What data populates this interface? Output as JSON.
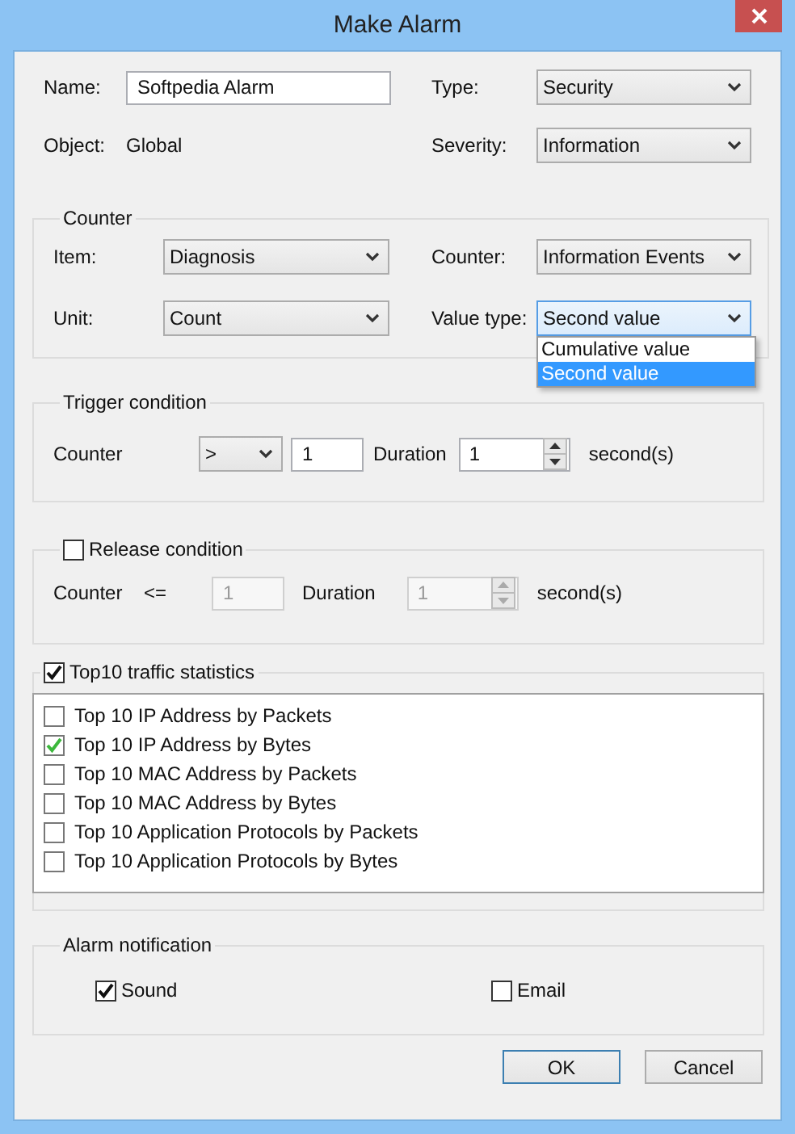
{
  "window": {
    "title": "Make Alarm"
  },
  "general": {
    "name": {
      "label": "Name:",
      "value": "Softpedia Alarm"
    },
    "object": {
      "label": "Object:",
      "value": "Global"
    },
    "type": {
      "label": "Type:",
      "value": "Security"
    },
    "severity": {
      "label": "Severity:",
      "value": "Information"
    }
  },
  "counter_group": {
    "title": "Counter",
    "item": {
      "label": "Item:",
      "value": "Diagnosis"
    },
    "counter": {
      "label": "Counter:",
      "value": "Information Events"
    },
    "unit": {
      "label": "Unit:",
      "value": "Count"
    },
    "value_type": {
      "label": "Value type:",
      "value": "Second value",
      "expanded": true,
      "options": [
        {
          "label": "Cumulative value",
          "selected": false
        },
        {
          "label": "Second value",
          "selected": true
        }
      ]
    }
  },
  "trigger": {
    "title": "Trigger condition",
    "counter_label": "Counter",
    "operator": ">",
    "threshold": "1",
    "duration_label": "Duration",
    "duration": "1",
    "unit": "second(s)"
  },
  "release": {
    "title": "Release condition",
    "checked": false,
    "counter_label": "Counter",
    "operator": "<=",
    "threshold": "1",
    "duration_label": "Duration",
    "duration": "1",
    "unit": "second(s)"
  },
  "top10": {
    "title": "Top10 traffic statistics",
    "checked": true,
    "items": [
      {
        "label": "Top 10 IP Address by Packets",
        "checked": false
      },
      {
        "label": "Top 10 IP Address by Bytes",
        "checked": true
      },
      {
        "label": "Top 10 MAC Address by Packets",
        "checked": false
      },
      {
        "label": "Top 10 MAC Address by Bytes",
        "checked": false
      },
      {
        "label": "Top 10 Application Protocols by Packets",
        "checked": false
      },
      {
        "label": "Top 10 Application Protocols by Bytes",
        "checked": false
      }
    ]
  },
  "notification": {
    "title": "Alarm notification",
    "options": [
      {
        "label": "Sound",
        "checked": true
      },
      {
        "label": "Email",
        "checked": false
      }
    ]
  },
  "buttons": [
    {
      "label": "OK",
      "default": true
    },
    {
      "label": "Cancel",
      "default": false
    }
  ]
}
